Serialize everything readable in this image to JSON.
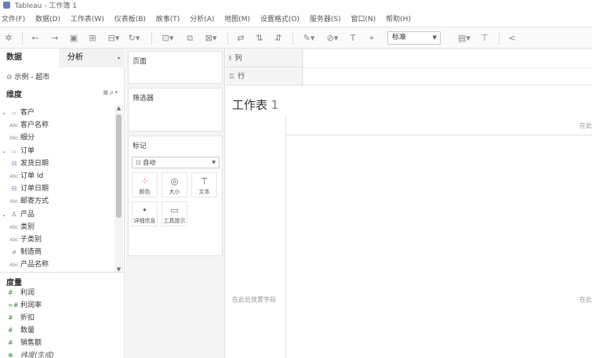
{
  "window": {
    "title": "Tableau - 工作簿 1"
  },
  "menu": [
    "文件(F)",
    "数据(D)",
    "工作表(W)",
    "仪表板(B)",
    "故事(T)",
    "分析(A)",
    "地图(M)",
    "设置格式(O)",
    "服务器(S)",
    "窗口(N)",
    "帮助(H)"
  ],
  "toolbar": {
    "icons": [
      "tableau-logo",
      "undo",
      "redo",
      "save",
      "new-datasource",
      "new-worksheet",
      "refresh",
      "swap",
      "show-me",
      "duplicate",
      "clear",
      "group",
      "sort-asc",
      "sort-desc",
      "highlight",
      "label",
      "fix-axes",
      "pin",
      "presentation",
      "share"
    ],
    "fit_value": "标准"
  },
  "left": {
    "tab_data": "数据",
    "tab_analysis": "分析",
    "datasource": "示例 - 超市",
    "dimensions_title": "维度",
    "tree": [
      {
        "kind": "folder",
        "label": "客户"
      },
      {
        "kind": "abc",
        "label": "客户名称"
      },
      {
        "kind": "abc",
        "label": "细分"
      },
      {
        "kind": "folder",
        "label": "订单"
      },
      {
        "kind": "date",
        "label": "发货日期"
      },
      {
        "kind": "abc",
        "label": "订单 Id"
      },
      {
        "kind": "date",
        "label": "订单日期"
      },
      {
        "kind": "abc",
        "label": "邮寄方式"
      },
      {
        "kind": "hier",
        "label": "产品"
      },
      {
        "kind": "abc",
        "label": "类别"
      },
      {
        "kind": "abc",
        "label": "子类别"
      },
      {
        "kind": "link",
        "label": "制造商"
      },
      {
        "kind": "abc",
        "label": "产品名称"
      }
    ],
    "measures_title": "度量",
    "measures": [
      {
        "label": "利润",
        "italic": false
      },
      {
        "label": "利润率",
        "italic": false
      },
      {
        "label": "折扣",
        "italic": false
      },
      {
        "label": "数量",
        "italic": false
      },
      {
        "label": "销售额",
        "italic": false
      },
      {
        "label": "纬度(生成)",
        "italic": true
      }
    ]
  },
  "mid": {
    "pages_title": "页面",
    "filters_title": "筛选器",
    "marks_title": "标记",
    "mark_type": "自动",
    "mark_buttons": [
      {
        "label": "颜色",
        "icon": "color-dots-icon"
      },
      {
        "label": "大小",
        "icon": "size-icon"
      },
      {
        "label": "文本",
        "icon": "text-icon"
      },
      {
        "label": "详细信息",
        "icon": "detail-icon"
      },
      {
        "label": "工具提示",
        "icon": "tooltip-icon"
      }
    ]
  },
  "shelves": {
    "columns": "列",
    "rows": "行"
  },
  "view": {
    "sheet_title": "工作表",
    "sheet_number": "1",
    "hint_drop_field": "在此处放置字段",
    "hint_top_right": "在此",
    "hint_right": "在此"
  }
}
